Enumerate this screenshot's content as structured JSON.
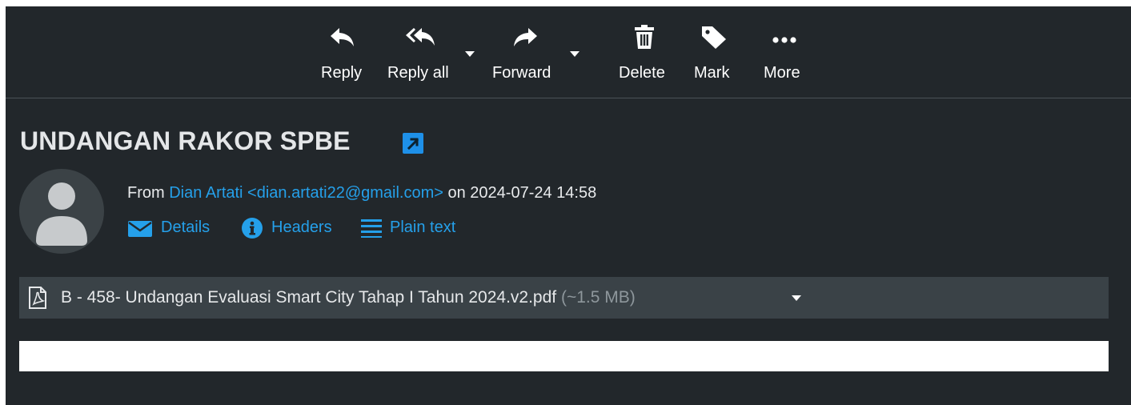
{
  "toolbar": {
    "reply_label": "Reply",
    "reply_all_label": "Reply all",
    "forward_label": "Forward",
    "delete_label": "Delete",
    "mark_label": "Mark",
    "more_label": "More"
  },
  "message": {
    "subject": "UNDANGAN RAKOR SPBE",
    "from_prefix": "From",
    "sender": "Dian Artati <dian.artati22@gmail.com>",
    "date_text": "on 2024-07-24 14:58",
    "links": {
      "details": "Details",
      "headers": "Headers",
      "plain_text": "Plain text"
    }
  },
  "attachment": {
    "filename": "B - 458- Undangan Evaluasi Smart City Tahap I Tahun 2024.v2.pdf",
    "size": "(~1.5 MB)"
  },
  "colors": {
    "background": "#22272b",
    "link": "#25a0ea",
    "attachment_bg": "#3a4247"
  }
}
